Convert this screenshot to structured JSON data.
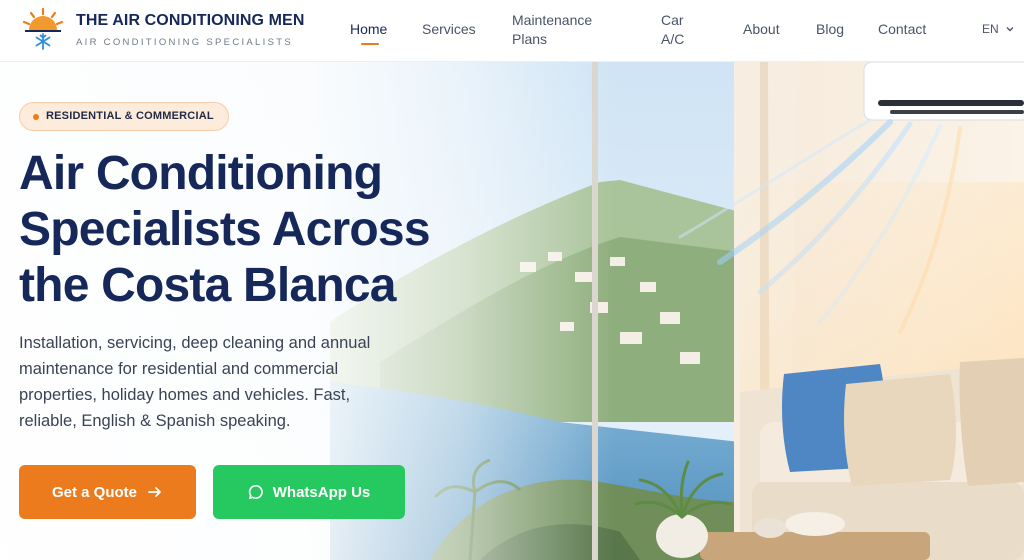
{
  "brand": {
    "name": "THE AIR CONDITIONING MEN",
    "tagline": "AIR CONDITIONING SPECIALISTS",
    "logo_icon": "sun-snowflake-logo"
  },
  "nav": {
    "items": [
      {
        "label": "Home",
        "active": true
      },
      {
        "label": "Services"
      },
      {
        "label": "Maintenance Plans"
      },
      {
        "label": "Car A/C"
      },
      {
        "label": "About"
      },
      {
        "label": "Blog"
      },
      {
        "label": "Contact"
      }
    ],
    "language": "EN"
  },
  "hero": {
    "badge": "RESIDENTIAL & COMMERCIAL",
    "title_lines": [
      "Air Conditioning",
      "Specialists Across",
      "the Costa Blanca"
    ],
    "description": "Installation, servicing, deep cleaning and annual maintenance for residential and commercial properties, holiday homes and vehicles. Fast, reliable, English & Spanish speaking.",
    "cta_primary": {
      "label": "Get a Quote",
      "icon": "arrow-right-icon"
    },
    "cta_secondary": {
      "label": "WhatsApp Us",
      "icon": "whatsapp-icon"
    }
  },
  "colors": {
    "navy": "#16285a",
    "accent_orange": "#ec7b1d",
    "whatsapp_green": "#26c95f",
    "badge_bg": "#fdebdc"
  }
}
